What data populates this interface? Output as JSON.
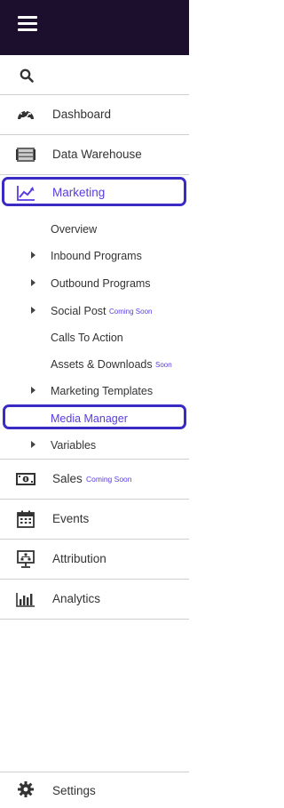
{
  "search": {
    "icon": "search-icon"
  },
  "nav": {
    "dashboard": "Dashboard",
    "data_warehouse": "Data Warehouse",
    "marketing": "Marketing",
    "sales": "Sales",
    "sales_badge": "Coming Soon",
    "events": "Events",
    "attribution": "Attribution",
    "analytics": "Analytics",
    "settings": "Settings"
  },
  "marketing_sub": {
    "overview": "Overview",
    "inbound": "Inbound Programs",
    "outbound": "Outbound Programs",
    "social": "Social Post",
    "social_badge": "Coming Soon",
    "cta": "Calls To Action",
    "assets": "Assets & Downloads",
    "assets_badge": "Soon",
    "templates": "Marketing Templates",
    "media": "Media Manager",
    "variables": "Variables"
  },
  "colors": {
    "topbar": "#1c0f2e",
    "accent": "#5a3ce0",
    "highlight": "#3a2bc4"
  }
}
